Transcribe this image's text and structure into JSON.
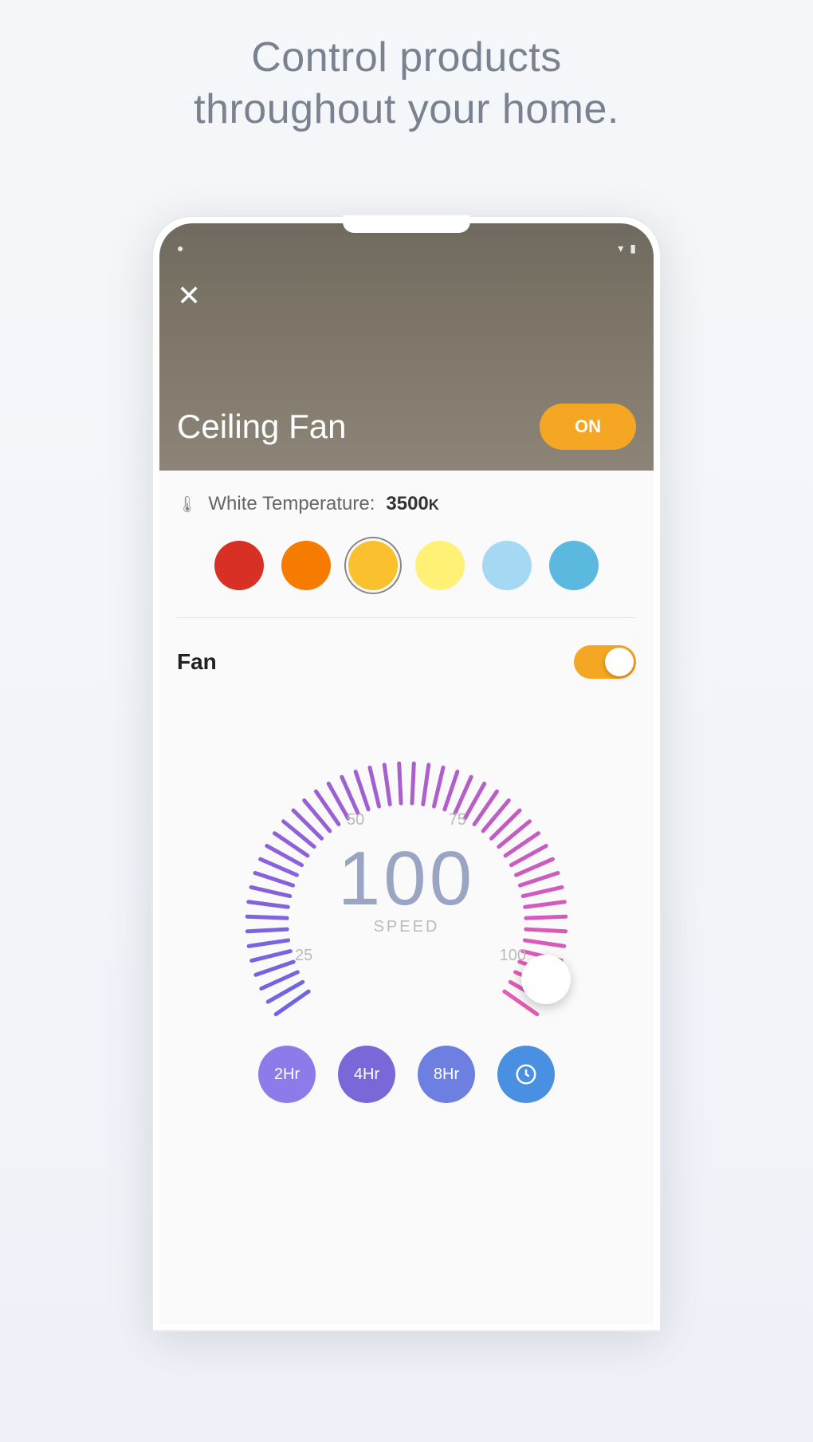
{
  "headline_line1": "Control products",
  "headline_line2": "throughout your home.",
  "device": {
    "name": "Ceiling Fan",
    "power_label": "ON"
  },
  "temperature": {
    "label": "White Temperature:",
    "value": "3500",
    "unit": "K"
  },
  "colors": [
    {
      "hex": "#d93025",
      "selected": false
    },
    {
      "hex": "#f57c00",
      "selected": false
    },
    {
      "hex": "#fbc02d",
      "selected": true
    },
    {
      "hex": "#fff176",
      "selected": false
    },
    {
      "hex": "#a5d8f3",
      "selected": false
    },
    {
      "hex": "#5bb8de",
      "selected": false
    }
  ],
  "fan": {
    "label": "Fan",
    "enabled": true,
    "speed_value": "100",
    "speed_caption": "SPEED",
    "ticks": {
      "t25": "25",
      "t50": "50",
      "t75": "75",
      "t100": "100"
    }
  },
  "timers": [
    {
      "label": "2Hr",
      "color": "#8e7bea"
    },
    {
      "label": "4Hr",
      "color": "#7a68d8"
    },
    {
      "label": "8Hr",
      "color": "#6d7fe0"
    },
    {
      "label": "clock-icon",
      "color": "#4a90e2",
      "is_icon": true
    }
  ]
}
